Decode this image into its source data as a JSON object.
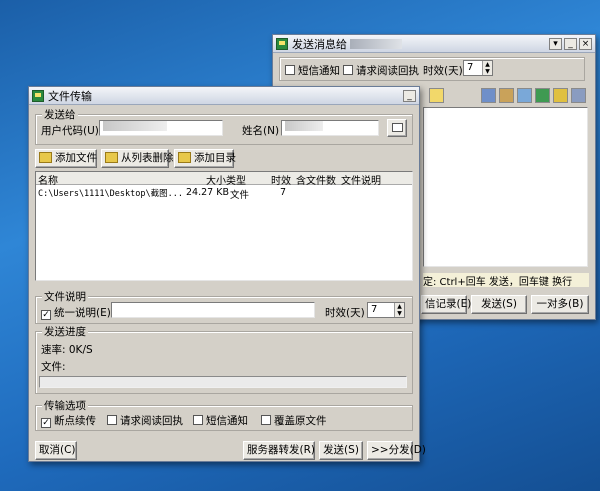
{
  "msg_window": {
    "title": "发送消息给",
    "sms_notify": "短信通知",
    "read_receipt": "请求阅读回执",
    "timeout_label": "时效(天)",
    "timeout_value": "7",
    "hint": "定: Ctrl+回车 发送，回车键 换行",
    "btn_records": "信记录(E)",
    "btn_send": "发送(S)",
    "btn_one_to_many": "一对多(B)",
    "toolbar_icons": [
      "note-icon",
      "window-icon",
      "pen-icon",
      "brush-icon",
      "image-icon",
      "face-icon",
      "link-icon"
    ]
  },
  "file_window": {
    "title": "文件传输",
    "send_to_legend": "发送给",
    "user_code_label": "用户代码(U)",
    "name_label": "姓名(N)",
    "btn_add_file": "添加文件",
    "btn_remove": "从列表删除",
    "btn_add_dir": "添加目录",
    "columns": [
      "名称",
      "大小",
      "类型",
      "时效",
      "含文件数",
      "文件说明"
    ],
    "rows": [
      {
        "name": "C:\\Users\\1111\\Desktop\\截图...",
        "size": "24.27 KB",
        "type": "文件",
        "timeout": "7",
        "files": "",
        "desc": ""
      }
    ],
    "file_desc_legend": "文件说明",
    "unified_desc": "统一说明(E)",
    "timeout_label": "时效(天)",
    "timeout_value": "7",
    "progress_legend": "发送进度",
    "rate": "速率: 0K/S",
    "file_label": "文件:",
    "options_legend": "传输选项",
    "opt_resume": "断点续传",
    "opt_receipt": "请求阅读回执",
    "opt_sms": "短信通知",
    "opt_overwrite": "覆盖原文件",
    "btn_cancel": "取消(C)",
    "btn_server_forward": "服务器转发(R)",
    "btn_send": "发送(S)",
    "btn_distribute": ">>分发(D)"
  }
}
